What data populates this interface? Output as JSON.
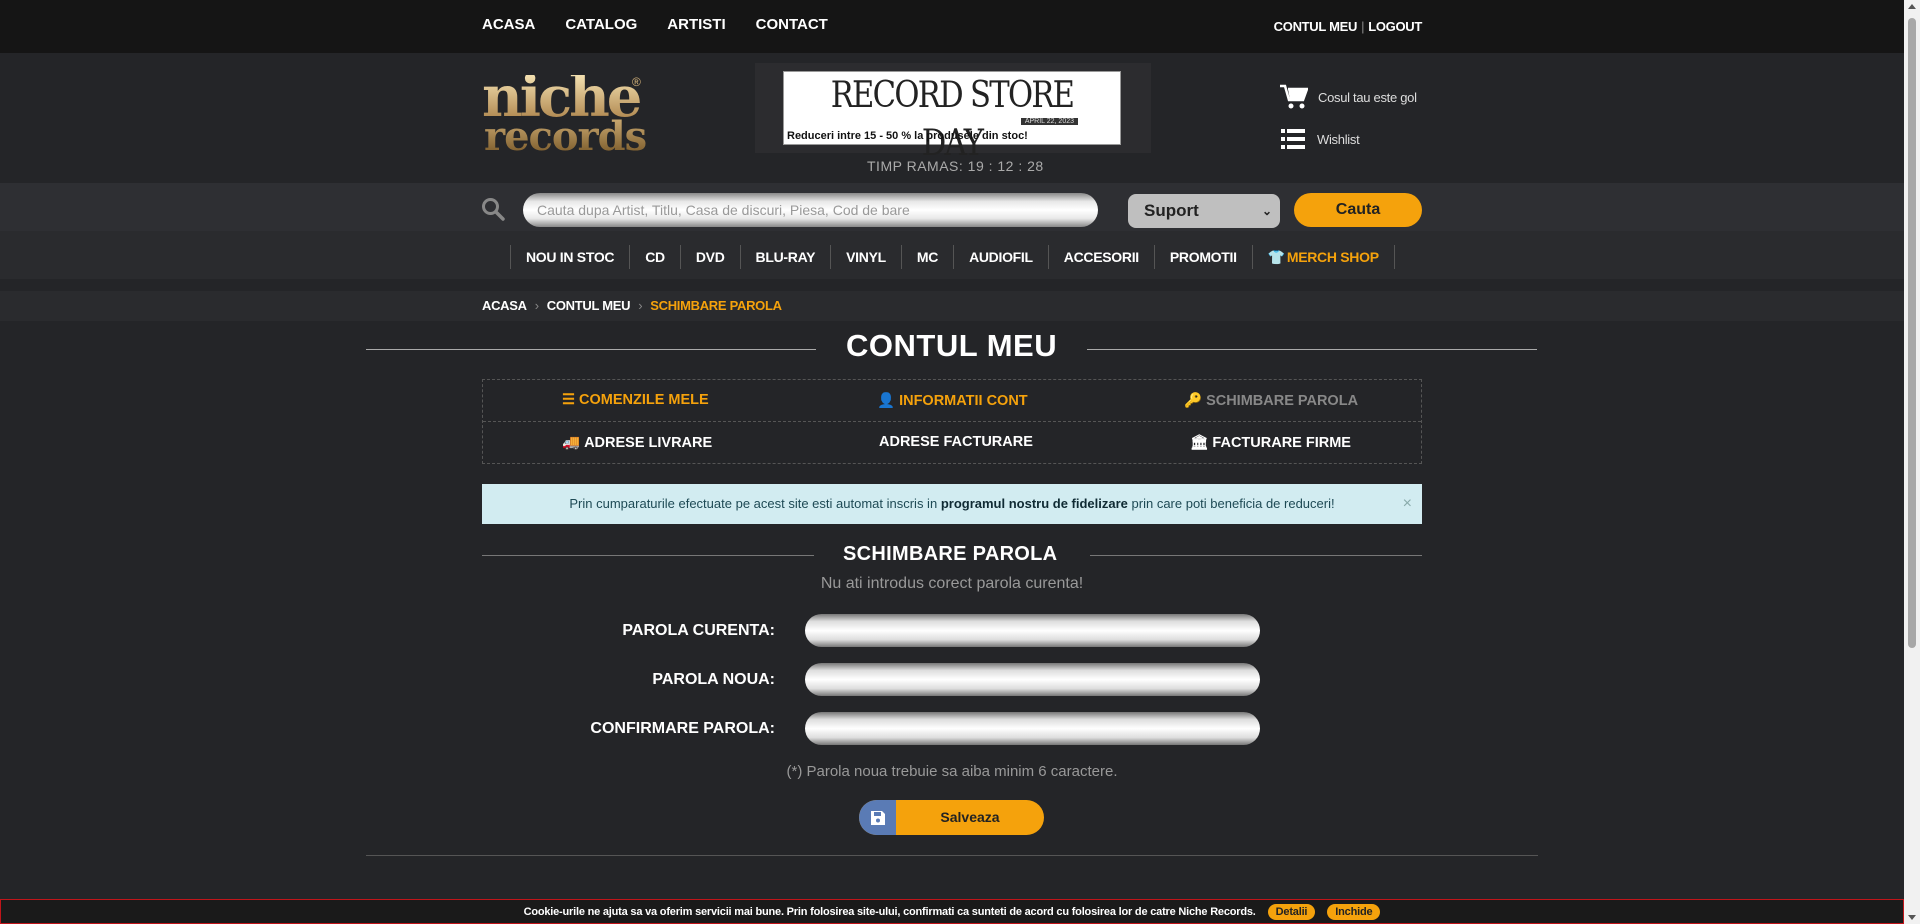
{
  "top_nav": {
    "items": [
      "ACASA",
      "CATALOG",
      "ARTISTI",
      "CONTACT"
    ],
    "account": "CONTUL MEU",
    "logout": "LOGOUT"
  },
  "header": {
    "logo_line1": "niche",
    "logo_line2": "records",
    "banner_title": "RECORD STORE DAY",
    "banner_date": "APRIL 22, 2023",
    "banner_subtitle": "Reduceri intre 15 - 50 % la produsele din stoc!",
    "timer_label": "TIMP RAMAS:",
    "timer_value": "19 : 12 : 28",
    "cart_text": "Cosul tau este gol",
    "wishlist_text": "Wishlist"
  },
  "search": {
    "placeholder": "Cauta dupa Artist, Titlu, Casa de discuri, Piesa, Cod de bare",
    "support_selected": "Suport",
    "button": "Cauta"
  },
  "categories": [
    "NOU IN STOC",
    "CD",
    "DVD",
    "BLU-RAY",
    "VINYL",
    "MC",
    "AUDIOFIL",
    "ACCESORII",
    "PROMOTII",
    "MERCH SHOP"
  ],
  "breadcrumb": [
    "ACASA",
    "CONTUL MEU",
    "SCHIMBARE PAROLA"
  ],
  "page_title": "CONTUL MEU",
  "account_tabs": {
    "orders": "COMENZILE MELE",
    "info": "INFORMATII CONT",
    "password": "SCHIMBARE PAROLA",
    "shipping": "ADRESE LIVRARE",
    "billing": "ADRESE FACTURARE",
    "company": "FACTURARE FIRME"
  },
  "alert": {
    "before": "Prin cumparaturile efectuate pe acest site esti automat inscris in",
    "bold": "programul nostru de fidelizare",
    "after": "prin care poti beneficia de reduceri!"
  },
  "form": {
    "title": "SCHIMBARE PAROLA",
    "error": "Nu ati introdus corect parola curenta!",
    "current_label": "PAROLA CURENTA:",
    "new_label": "PAROLA NOUA:",
    "confirm_label": "CONFIRMARE PAROLA:",
    "current_value": "",
    "new_value": "",
    "confirm_value": "",
    "note": "(*) Parola noua trebuie sa aiba minim 6 caractere.",
    "save": "Salveaza"
  },
  "cookie": {
    "text": "Cookie-urile ne ajuta sa va oferim servicii mai bune. Prin folosirea site-ului, confirmati ca sunteti de acord cu folosirea lor de catre Niche Records.",
    "details": "Detalii",
    "close": "Inchide"
  },
  "colors": {
    "accent": "#f5a20c",
    "background": "#242528",
    "alert_bg": "#d2ecf1"
  }
}
